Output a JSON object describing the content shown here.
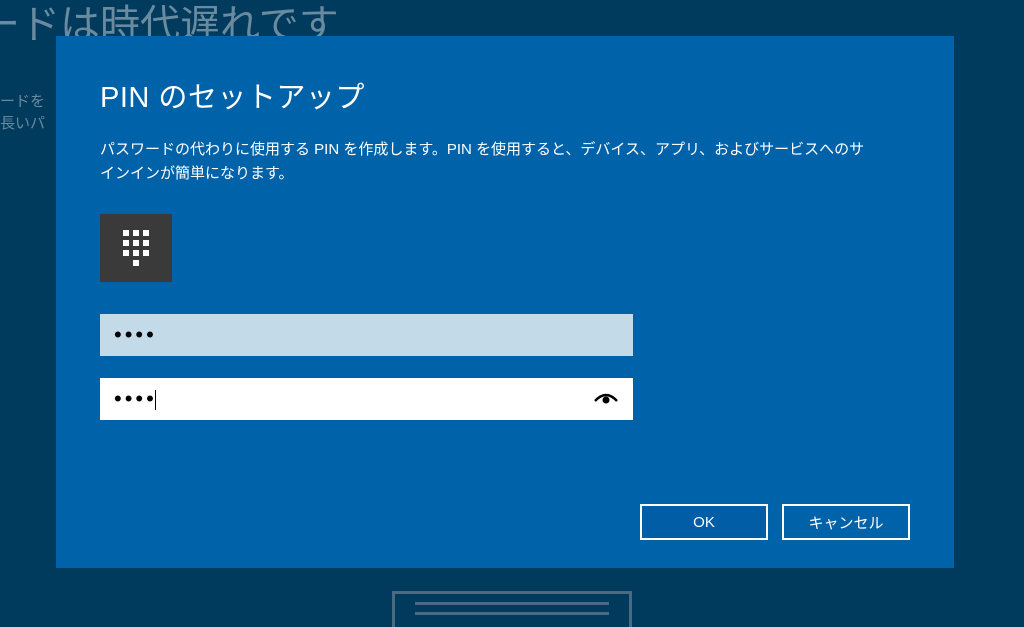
{
  "background": {
    "heading": "ードは時代遅れです",
    "line1": "ードを",
    "line2": "長いパ"
  },
  "dialog": {
    "title": "PIN のセットアップ",
    "description": "パスワードの代わりに使用する PIN を作成します。PIN を使用すると、デバイス、アプリ、およびサービスへのサインインが簡単になります。",
    "pin_field": {
      "value": "••••",
      "placeholder": ""
    },
    "confirm_pin_field": {
      "value": "••••",
      "placeholder": ""
    },
    "buttons": {
      "ok": "OK",
      "cancel": "キャンセル"
    }
  },
  "icons": {
    "keypad": "keypad-icon",
    "reveal": "password-reveal-icon"
  }
}
